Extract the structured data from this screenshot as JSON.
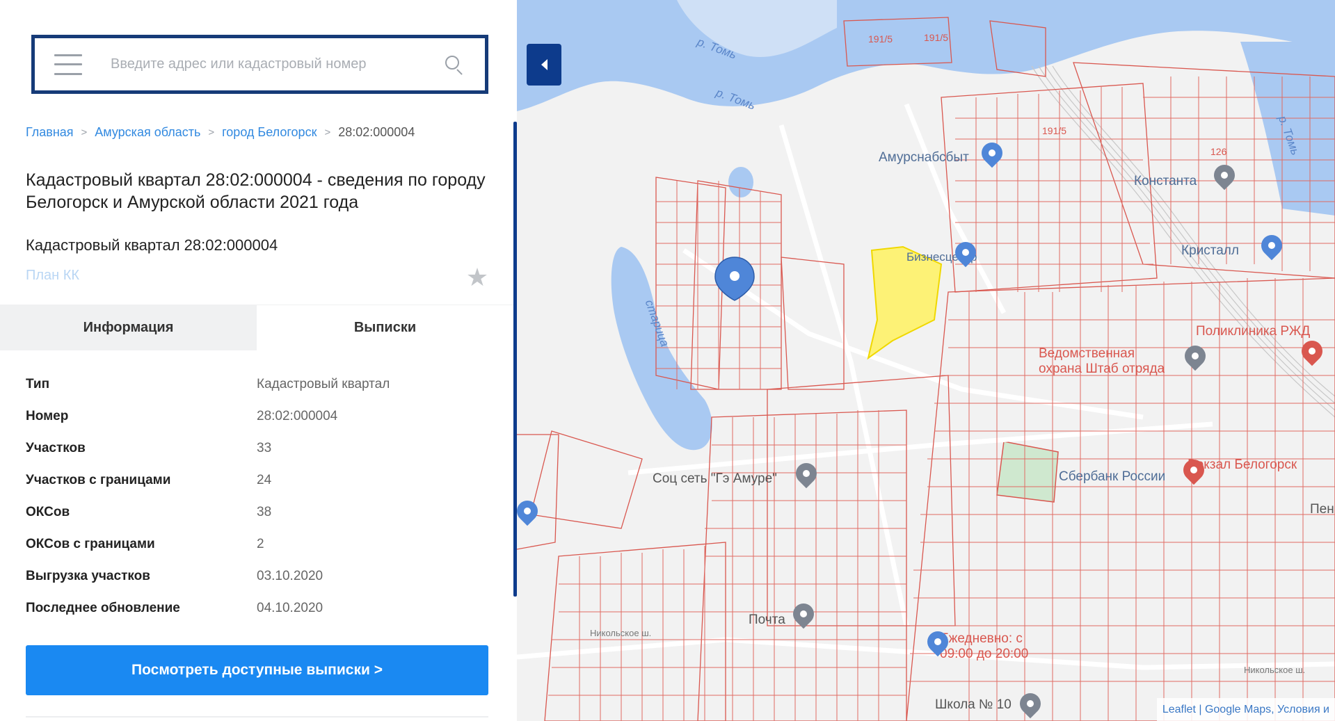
{
  "search": {
    "placeholder": "Введите адрес или кадастровый номер",
    "value": ""
  },
  "breadcrumb": {
    "items": [
      "Главная",
      "Амурская область",
      "город Белогорск"
    ],
    "separator": ">",
    "current": "28:02:000004"
  },
  "page_title": "Кадастровый квартал 28:02:000004 - сведения по городу Белогорск и Амурской области 2021 года",
  "subtitle": "Кадастровый квартал 28:02:000004",
  "plan_link": "План КК",
  "tabs": [
    {
      "label": "Информация",
      "active": true
    },
    {
      "label": "Выписки",
      "active": false
    }
  ],
  "info": [
    {
      "label": "Тип",
      "value": "Кадастровый квартал"
    },
    {
      "label": "Номер",
      "value": "28:02:000004"
    },
    {
      "label": "Участков",
      "value": "33"
    },
    {
      "label": "Участков с границами",
      "value": "24"
    },
    {
      "label": "ОКСов",
      "value": "38"
    },
    {
      "label": "ОКСов с границами",
      "value": "2"
    },
    {
      "label": "Выгрузка участков",
      "value": "03.10.2020"
    },
    {
      "label": "Последнее обновление",
      "value": "04.10.2020"
    }
  ],
  "cta_button": "Посмотреть доступные выписки >",
  "map": {
    "labels": {
      "river_1": "р. Томь",
      "river_2": "р. Томь",
      "river_3": "р. Томь",
      "oxbow": "старица",
      "amursnab": "Амурснабсбыт",
      "konstanta": "Константа",
      "kristall": "Кристалл",
      "polyclinic": "Поликлиника РЖД",
      "guard": "Ведомственная охрана Штаб отряда",
      "biz": "Бизнесцентр",
      "sberbank": "Сбербанк России",
      "station": "Вокзал Белогорск",
      "social": "Соц сеть \"Гэ Амуре\"",
      "post": "Почта",
      "daily": "Ежедневно: с 09:00 до 20:00",
      "school": "Школа № 10",
      "parcel_1": "191/5",
      "parcel_2": "191/5",
      "parcel_3": "191/5",
      "parcel_4": "126",
      "nikolskoe_1": "Никольское ш.",
      "nikolskoe_2": "Никольское ш.",
      "pen": "Пен"
    },
    "attribution": "Leaflet | Google Maps, Условия и",
    "colors": {
      "water": "#a9c9f2",
      "parcel_lines": "#d9574f",
      "highlight": "#fff260",
      "marker": "#4f86d8",
      "panel_accent": "#0d3b8c",
      "button": "#1a89f2"
    }
  }
}
